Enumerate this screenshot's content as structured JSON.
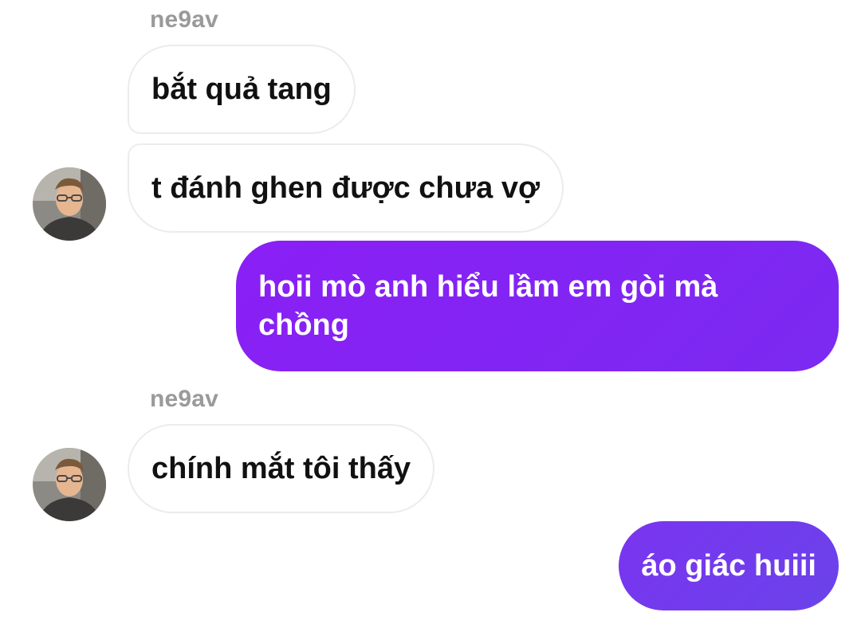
{
  "chat": {
    "groups": [
      {
        "sender": "ne9av",
        "messages": [
          "bắt quả tang",
          "t đánh ghen được chưa vợ"
        ]
      },
      {
        "sender": "ne9av",
        "messages": [
          "chính mắt tôi thấy"
        ]
      }
    ],
    "outgoing": [
      "hoii mò anh hiểu lầm em gòi mà chồng",
      "áo giác huiii"
    ]
  },
  "colors": {
    "outgoing_bubble": "#8a1ff5",
    "outgoing_bubble_2": "#6a43ea",
    "incoming_border": "#ececec",
    "sender_name": "#9a9a9a"
  },
  "icons": {
    "avatar": "user-avatar-photo"
  }
}
